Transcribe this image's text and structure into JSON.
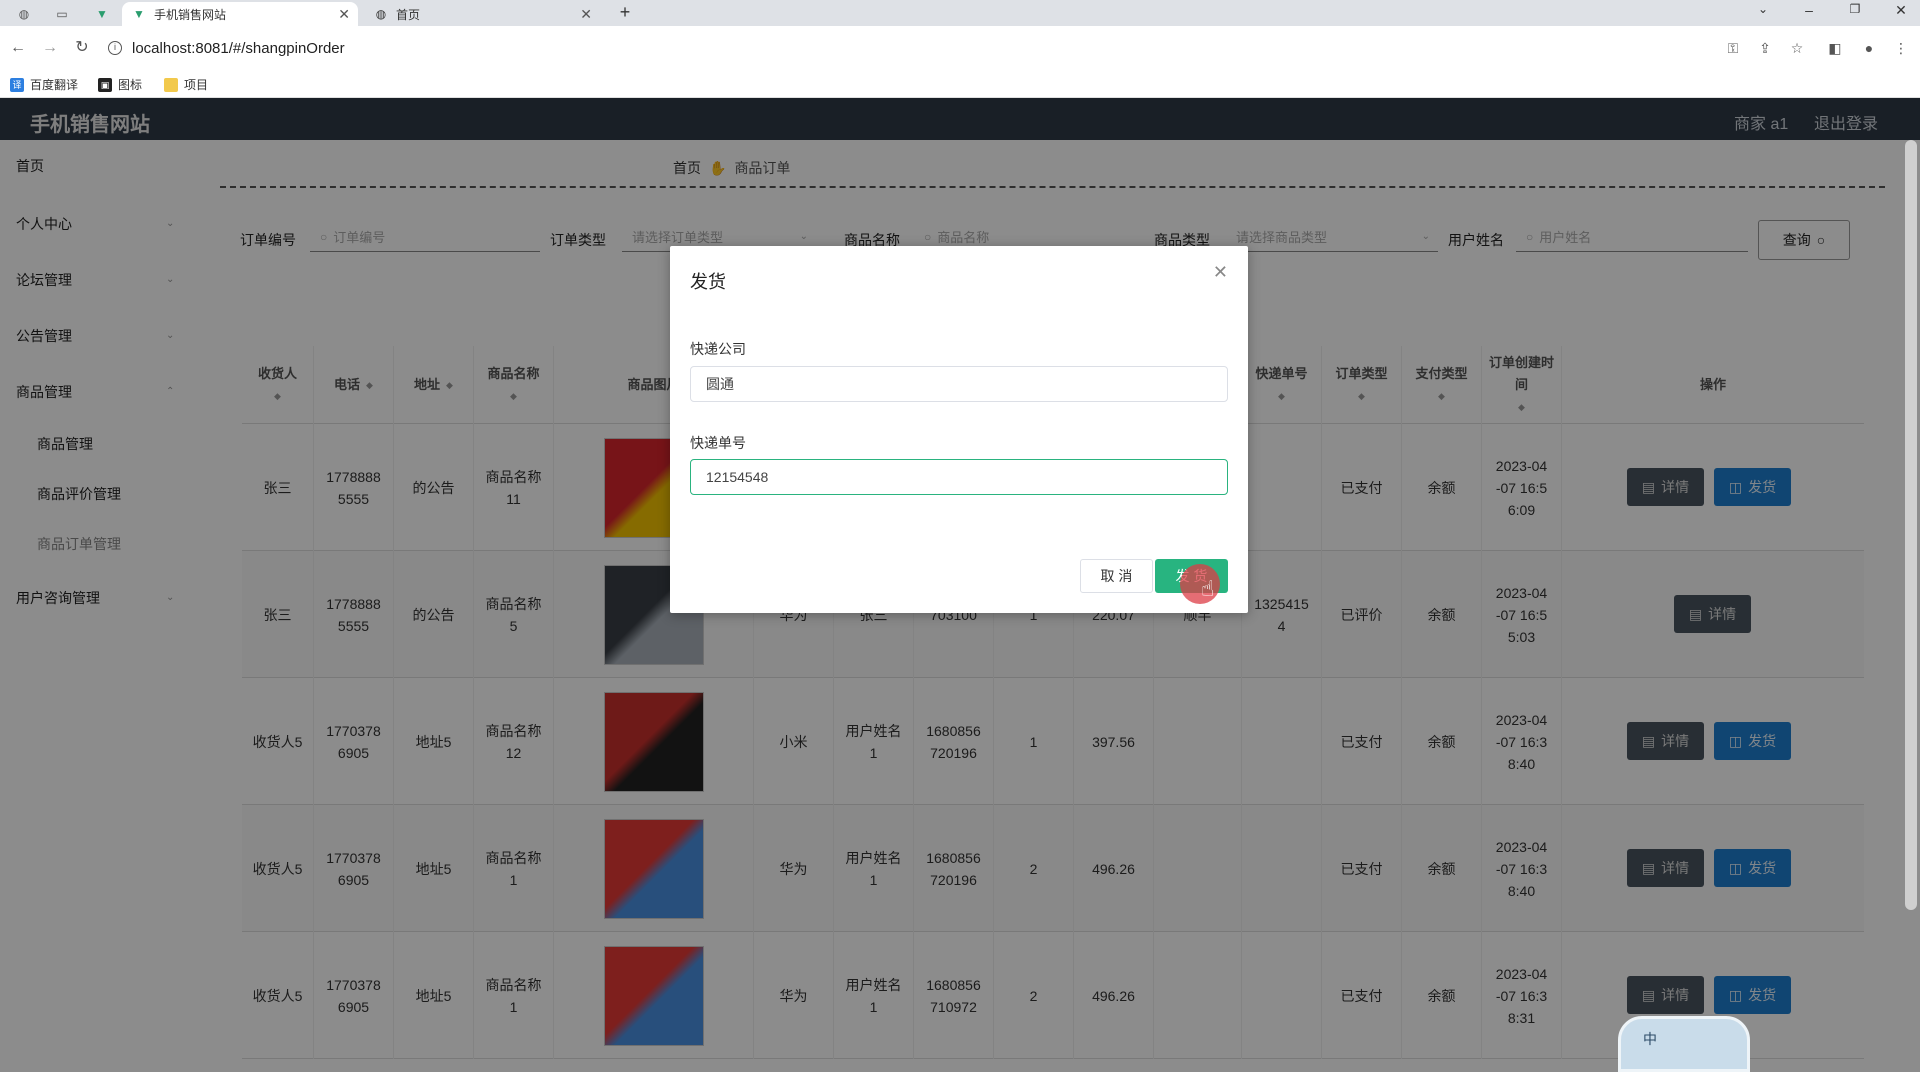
{
  "browser": {
    "tabs": [
      {
        "title": "手机销售网站",
        "active": true
      },
      {
        "title": "首页",
        "active": false
      }
    ],
    "new_tab": "+",
    "url": "localhost:8081/#/shangpinOrder",
    "bookmarks": [
      "百度翻译",
      "图标",
      "项目"
    ]
  },
  "header": {
    "title": "手机销售网站",
    "user": "商家 a1",
    "logout": "退出登录"
  },
  "sidebar": {
    "items": [
      {
        "label": "首页"
      },
      {
        "label": "个人中心"
      },
      {
        "label": "论坛管理"
      },
      {
        "label": "公告管理"
      },
      {
        "label": "商品管理"
      },
      {
        "label": "用户咨询管理"
      }
    ],
    "sub_items": [
      {
        "label": "商品管理"
      },
      {
        "label": "商品评价管理"
      },
      {
        "label": "商品订单管理"
      }
    ]
  },
  "breadcrumb": {
    "home": "首页",
    "current": "商品订单"
  },
  "filters": {
    "order_no_label": "订单编号",
    "order_no_placeholder": "订单编号",
    "order_type_label": "订单类型",
    "order_type_placeholder": "请选择订单类型",
    "product_name_label": "商品名称",
    "product_name_placeholder": "商品名称",
    "product_type_label": "商品类型",
    "product_type_placeholder": "请选择商品类型",
    "user_name_label": "用户姓名",
    "user_name_placeholder": "用户姓名",
    "query_button": "查询"
  },
  "table": {
    "columns": [
      "收货人",
      "电话",
      "地址",
      "商品名称",
      "商品图片",
      "快递单号",
      "订单类型",
      "支付类型",
      "订单创建时间",
      "操作"
    ],
    "rows": [
      {
        "receiver": "张三",
        "phone": "17788885555",
        "address": "的公告",
        "product": "商品名称11",
        "category": "",
        "user": "",
        "order_no": "",
        "qty": "",
        "price": "",
        "express": "",
        "express_no": "",
        "order_type": "已支付",
        "pay_type": "余额",
        "created": "2023-04-07 16:56:09",
        "actions": [
          "详情",
          "发货"
        ]
      },
      {
        "receiver": "张三",
        "phone": "17788885555",
        "address": "的公告",
        "product": "商品名称5",
        "category": "华为",
        "user": "张三",
        "order_no": "703100",
        "qty": "1",
        "price": "220.07",
        "express": "顺丰",
        "express_no": "13254154",
        "order_type": "已评价",
        "pay_type": "余额",
        "created": "2023-04-07 16:55:03",
        "actions": [
          "详情"
        ]
      },
      {
        "receiver": "收货人5",
        "phone": "17703786905",
        "address": "地址5",
        "product": "商品名称12",
        "category": "小米",
        "user": "用户姓名1",
        "order_no": "1680856720196",
        "qty": "1",
        "price": "397.56",
        "express": "",
        "express_no": "",
        "order_type": "已支付",
        "pay_type": "余额",
        "created": "2023-04-07 16:38:40",
        "actions": [
          "详情",
          "发货"
        ]
      },
      {
        "receiver": "收货人5",
        "phone": "17703786905",
        "address": "地址5",
        "product": "商品名称1",
        "category": "华为",
        "user": "用户姓名1",
        "order_no": "1680856720196",
        "qty": "2",
        "price": "496.26",
        "express": "",
        "express_no": "",
        "order_type": "已支付",
        "pay_type": "余额",
        "created": "2023-04-07 16:38:40",
        "actions": [
          "详情",
          "发货"
        ]
      },
      {
        "receiver": "收货人5",
        "phone": "17703786905",
        "address": "地址5",
        "product": "商品名称1",
        "category": "华为",
        "user": "用户姓名1",
        "order_no": "1680856710972",
        "qty": "2",
        "price": "496.26",
        "express": "",
        "express_no": "",
        "order_type": "已支付",
        "pay_type": "余额",
        "created": "2023-04-07 16:38:31",
        "actions": [
          "详情",
          "发货"
        ]
      }
    ]
  },
  "dialog": {
    "title": "发货",
    "company_label": "快递公司",
    "company_value": "圆通",
    "number_label": "快递单号",
    "number_value": "12154548",
    "cancel": "取 消",
    "confirm": "发 货"
  },
  "ime": {
    "label": "中"
  },
  "colors": {
    "header_bg": "#2f3a45",
    "confirm": "#28b480",
    "ship_btn": "#1e7fd0",
    "detail_btn": "#4a5560"
  }
}
